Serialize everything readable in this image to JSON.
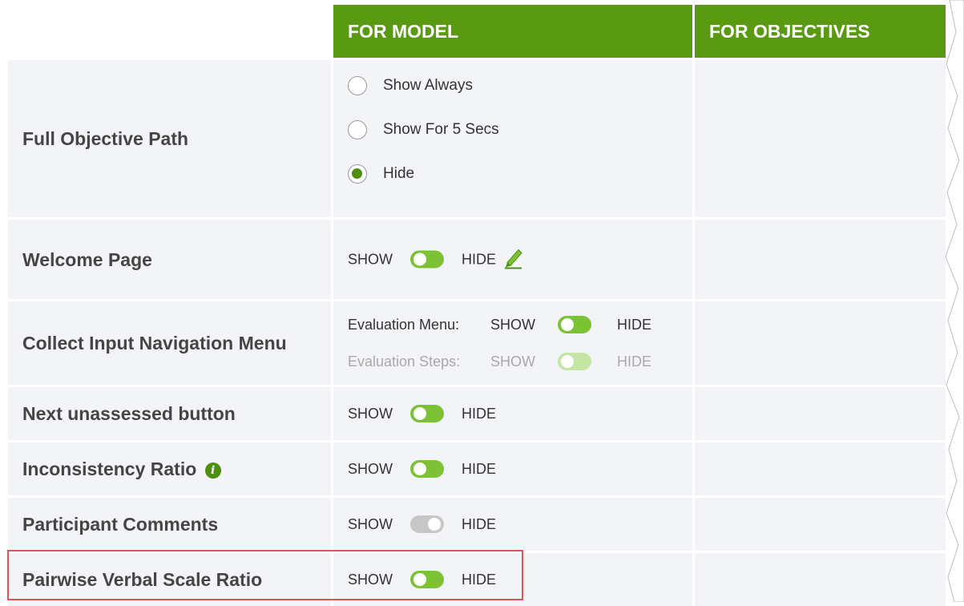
{
  "header": {
    "col_model": "FOR MODEL",
    "col_objectives": "FOR OBJECTIVES"
  },
  "rows": {
    "full_objective_path": {
      "label": "Full Objective Path",
      "options": [
        "Show Always",
        "Show For 5 Secs",
        "Hide"
      ],
      "selected": "Hide"
    },
    "welcome_page": {
      "label": "Welcome Page",
      "show": "SHOW",
      "hide": "HIDE",
      "state": "show",
      "icon": "pencil-icon"
    },
    "collect_input": {
      "label": "Collect Input Navigation Menu",
      "evaluation_menu": {
        "label": "Evaluation Menu:",
        "show": "SHOW",
        "hide": "HIDE",
        "state": "show"
      },
      "evaluation_steps": {
        "label": "Evaluation Steps:",
        "show": "SHOW",
        "hide": "HIDE",
        "state": "show",
        "disabled": true
      }
    },
    "next_unassessed": {
      "label": "Next unassessed button",
      "show": "SHOW",
      "hide": "HIDE",
      "state": "show"
    },
    "inconsistency_ratio": {
      "label": "Inconsistency Ratio",
      "show": "SHOW",
      "hide": "HIDE",
      "state": "show",
      "icon": "info-icon"
    },
    "participant_comments": {
      "label": "Participant Comments",
      "show": "SHOW",
      "hide": "HIDE",
      "state": "hide"
    },
    "pairwise_verbal": {
      "label": "Pairwise Verbal Scale Ratio",
      "show": "SHOW",
      "hide": "HIDE",
      "state": "show",
      "highlighted": true
    }
  },
  "colors": {
    "accent": "#5a9a12",
    "row_bg": "#f3f4f7",
    "highlight": "#e25555"
  }
}
